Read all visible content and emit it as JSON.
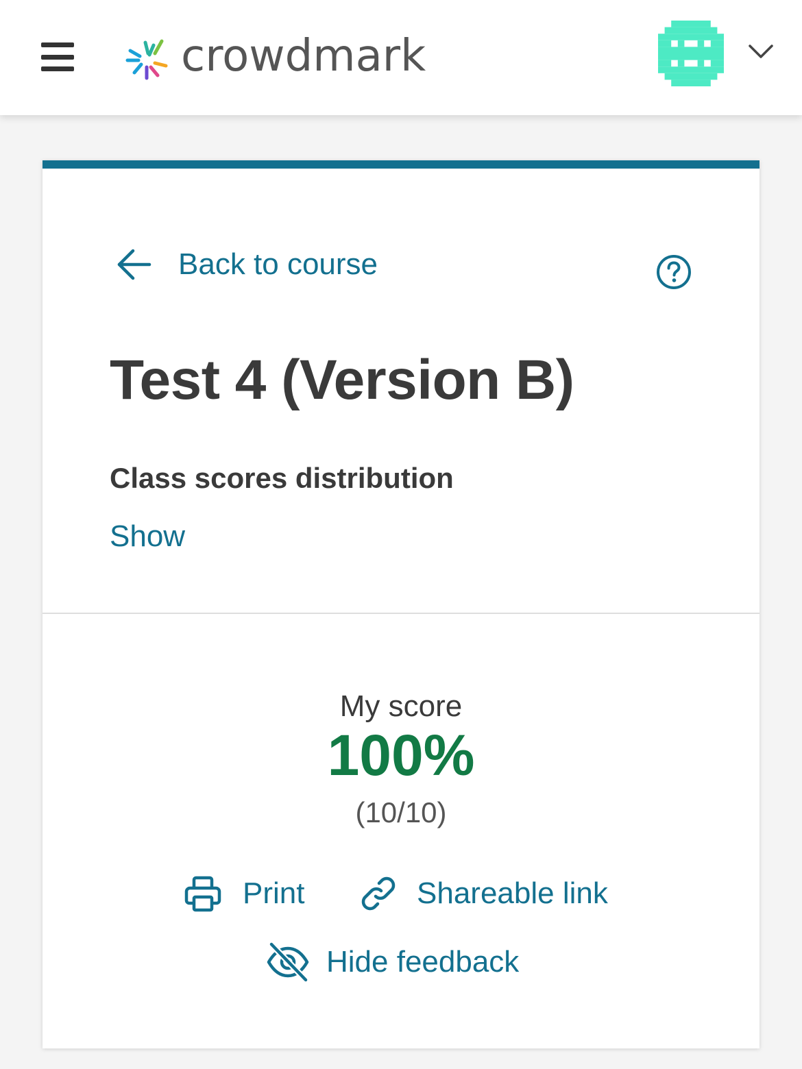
{
  "header": {
    "menu_icon": "hamburger-menu-icon",
    "brand_name": "crowdmark",
    "avatar_icon": "identicon-avatar",
    "dropdown_icon": "chevron-down-icon",
    "accent_colors": [
      "#2bb3a0",
      "#f4a623",
      "#6c4ad1",
      "#e0488b",
      "#1aa0d8"
    ],
    "avatar_color": "#4deac4"
  },
  "card": {
    "accent_color": "#13708f",
    "back_label": "Back to course",
    "help_icon": "help-circle-icon",
    "title": "Test 4 (Version B)",
    "distribution_label": "Class scores distribution",
    "distribution_toggle": "Show"
  },
  "score": {
    "label": "My score",
    "percent": "100%",
    "fraction": "(10/10)",
    "color": "#127a45"
  },
  "actions": {
    "print_label": "Print",
    "share_label": "Shareable link",
    "hide_label": "Hide feedback"
  }
}
